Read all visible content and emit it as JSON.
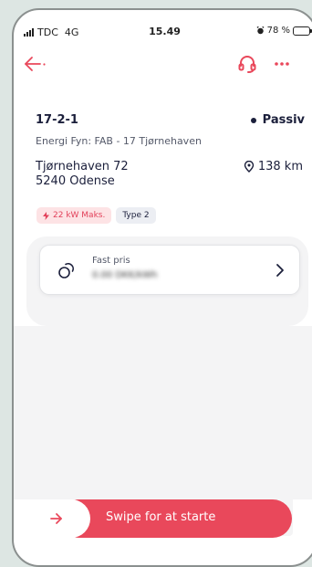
{
  "status_bar": {
    "carrier": "TDC",
    "network": "4G",
    "time": "15.49",
    "battery": "78 %",
    "battery_level": 0.78
  },
  "header": {
    "back_icon": "arrow-left-icon",
    "support_icon": "headset-icon",
    "more_icon": "more-dots-icon"
  },
  "station": {
    "id": "17-2-1",
    "status": "Passiv",
    "operator": "Energi Fyn: FAB - 17 Tjørnehaven",
    "address_line1": "Tjørnehaven 72",
    "address_line2": "5240 Odense",
    "distance": "138 km"
  },
  "tags": {
    "power": "22 kW Maks.",
    "type": "Type 2"
  },
  "price": {
    "label": "Fast pris",
    "value": "0.00 DKK/kWh"
  },
  "swipe": {
    "label": "Swipe for at starte"
  },
  "colors": {
    "accent": "#e9485b",
    "text_dark": "#1b1f3b",
    "tag_bg": "#fde3e5",
    "panel_bg": "#f4f4f5"
  }
}
